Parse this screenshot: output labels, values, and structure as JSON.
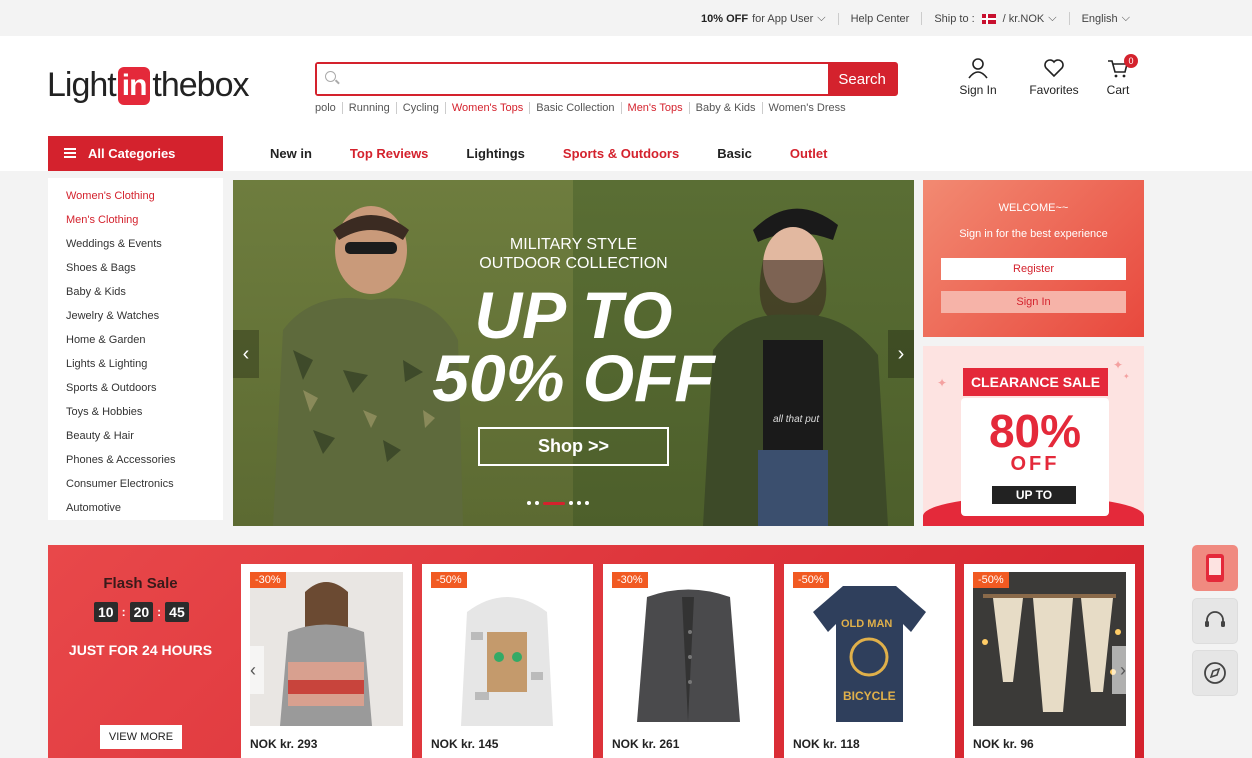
{
  "topbar": {
    "promo_bold": "10% OFF",
    "promo_rest": "for App User",
    "help": "Help Center",
    "ship_label": "Ship to :",
    "currency": "/ kr.NOK",
    "language": "English"
  },
  "logo": {
    "part1": "Light",
    "part2": "in",
    "part3": "thebox"
  },
  "search": {
    "placeholder": "",
    "button": "Search"
  },
  "hot_searches": [
    {
      "label": "polo",
      "red": false
    },
    {
      "label": "Running",
      "red": false
    },
    {
      "label": "Cycling",
      "red": false
    },
    {
      "label": "Women's Tops",
      "red": true
    },
    {
      "label": "Basic Collection",
      "red": false
    },
    {
      "label": "Men's Tops",
      "red": true
    },
    {
      "label": "Baby & Kids",
      "red": false
    },
    {
      "label": "Women's Dress",
      "red": false
    }
  ],
  "user": {
    "sign_in": "Sign In",
    "favorites": "Favorites",
    "cart": "Cart",
    "cart_count": "0"
  },
  "nav": {
    "all_categories": "All Categories",
    "links": [
      {
        "label": "New in",
        "red": false
      },
      {
        "label": "Top Reviews",
        "red": true
      },
      {
        "label": "Lightings",
        "red": false
      },
      {
        "label": "Sports & Outdoors",
        "red": true
      },
      {
        "label": "Basic",
        "red": false
      },
      {
        "label": "Outlet",
        "red": true
      }
    ]
  },
  "categories": [
    {
      "label": "Women's Clothing",
      "red": true
    },
    {
      "label": "Men's Clothing",
      "red": true
    },
    {
      "label": "Weddings & Events",
      "red": false
    },
    {
      "label": "Shoes & Bags",
      "red": false
    },
    {
      "label": "Baby & Kids",
      "red": false
    },
    {
      "label": "Jewelry & Watches",
      "red": false
    },
    {
      "label": "Home & Garden",
      "red": false
    },
    {
      "label": "Lights & Lighting",
      "red": false
    },
    {
      "label": "Sports & Outdoors",
      "red": false
    },
    {
      "label": "Toys & Hobbies",
      "red": false
    },
    {
      "label": "Beauty & Hair",
      "red": false
    },
    {
      "label": "Phones & Accessories",
      "red": false
    },
    {
      "label": "Consumer Electronics",
      "red": false
    },
    {
      "label": "Automotive",
      "red": false
    }
  ],
  "banner": {
    "line1": "MILITARY STYLE",
    "line2": "OUTDOOR COLLECTION",
    "big1": "UP TO",
    "big2": "50% OFF",
    "cta": "Shop >>",
    "shirt_text": "all that put"
  },
  "welcome": {
    "title": "WELCOME~~",
    "subtitle": "Sign in for the best experience",
    "register": "Register",
    "sign_in": "Sign In"
  },
  "clearance": {
    "tag": "CLEARANCE SALE",
    "percent": "80%",
    "off": "OFF",
    "up_to": "UP TO"
  },
  "flash_sale": {
    "title": "Flash Sale",
    "hours": "10",
    "minutes": "20",
    "seconds": "45",
    "sep": ":",
    "subtitle": "JUST FOR 24 HOURS",
    "view_more": "VIEW MORE",
    "products": [
      {
        "discount": "-30%",
        "price": "NOK kr. 293",
        "image": "striped-hoodie"
      },
      {
        "discount": "-50%",
        "price": "NOK kr. 145",
        "image": "cat-print-hoodie"
      },
      {
        "discount": "-30%",
        "price": "NOK kr. 261",
        "image": "grey-cardigan"
      },
      {
        "discount": "-50%",
        "price": "NOK kr. 118",
        "image": "cycling-jersey",
        "jersey_text1": "OLD MAN",
        "jersey_text2": "BICYCLE"
      },
      {
        "discount": "-50%",
        "price": "NOK kr. 96",
        "image": "macrame-wall-hanging"
      }
    ]
  },
  "colors": {
    "brand_red": "#d4222d",
    "discount_orange": "#f15a22"
  }
}
